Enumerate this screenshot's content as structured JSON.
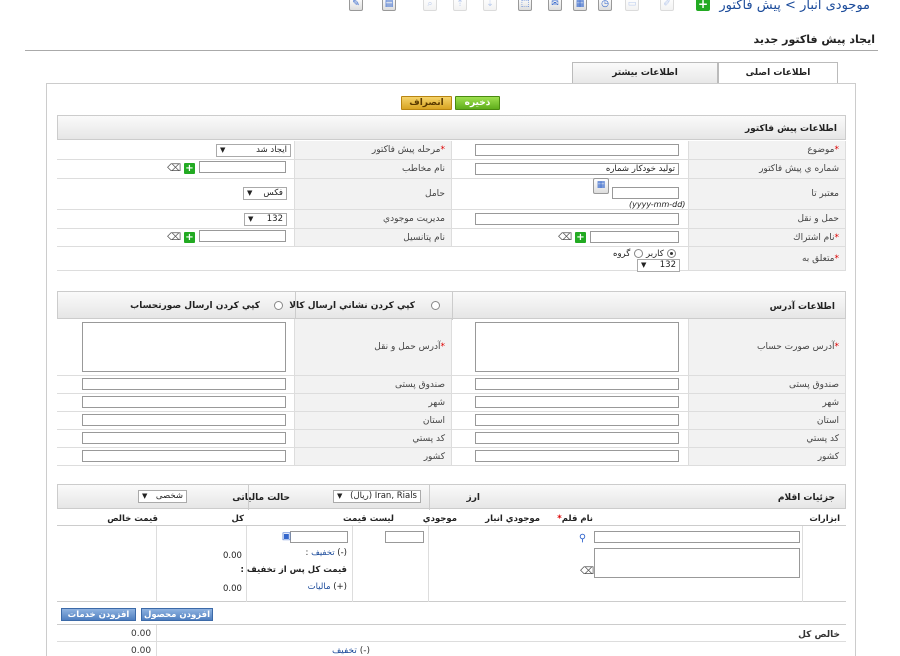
{
  "header": {
    "breadcrumb_root": "موجودی انبار",
    "breadcrumb_sep": ">",
    "breadcrumb_current": "پیش فاکتور",
    "page_title": "ایجاد پیش فاکتور جدید"
  },
  "toolbar": {
    "icons": [
      "edit-icon",
      "print-icon",
      "search-icon",
      "upload-icon",
      "download-icon",
      "import-icon",
      "chat-icon",
      "calculator-icon",
      "clock-icon",
      "calendar-icon",
      "pencil-icon",
      "add-icon"
    ]
  },
  "tabs": {
    "main": "اطلاعات اصلی",
    "more": "اطلاعات بیشتر"
  },
  "actions": {
    "save": "ذخیره",
    "cancel": "انصراف"
  },
  "quote_info": {
    "section_title": "اطلاعات پیش فاکتور",
    "subject_label": "موضوع",
    "stage_label": "مرحله پیش فاکتور",
    "stage_value": "ایجاد شد",
    "number_label": "شماره ي پيش فاكتور",
    "number_value": "تولید خودکار شماره",
    "contact_label": "نام مخاطب",
    "valid_until_label": "معتبر تا",
    "date_hint": "(yyyy-mm-dd)",
    "carrier_label": "حامل",
    "carrier_value": "فكس",
    "shipping_label": "حمل و نقل",
    "inventory_manager_label": "مديريت موجودي",
    "inventory_manager_value": "132",
    "account_label": "نام اشتراك",
    "potential_label": "نام پتانسیل",
    "assigned_label": "متعلق به",
    "user_option": "كاربر",
    "group_option": "گروه",
    "assigned_value": "132"
  },
  "address": {
    "section_title": "اطلاعات آدرس",
    "copy_shipping": "كپي كردن نشاني ارسال كالا",
    "copy_billing": "كپي كردن ارسال صورتحساب",
    "billing_address_label": "آدرس صورت حساب",
    "shipping_address_label": "آدرس حمل و نقل",
    "po_box_label": "صندوق پستی",
    "city_label": "شهر",
    "state_label": "استان",
    "postal_code_label": "كد پستي",
    "country_label": "كشور"
  },
  "items": {
    "section_title": "جزئيات اقلام",
    "currency_label": "ارز",
    "currency_value": "Iran, Rials (ریال)",
    "tax_mode_label": "حالت مالیاتی",
    "tax_mode_value": "شخصی",
    "col_tools": "ابزارات",
    "col_item_name": "نام قلم",
    "col_stock": "موجودي انبار",
    "col_qty": "موجودي",
    "col_list_price": "ليست قيمت",
    "col_total": "كل",
    "col_net_price": "قيمت خالص",
    "discount_link": "تخفيف",
    "discount_prefix": "(-)",
    "after_discount_label": "قيمت كل پس از تخفيف :",
    "tax_link": "ماليات",
    "tax_prefix": "(+)",
    "total_value": "0.00",
    "net_value": "0.00",
    "add_product": "افزودن محصول",
    "add_service": "افزودن خدمات",
    "net_total_label": "خالص كل",
    "net_total_value": "0.00",
    "bottom_discount_value": "0.00"
  }
}
